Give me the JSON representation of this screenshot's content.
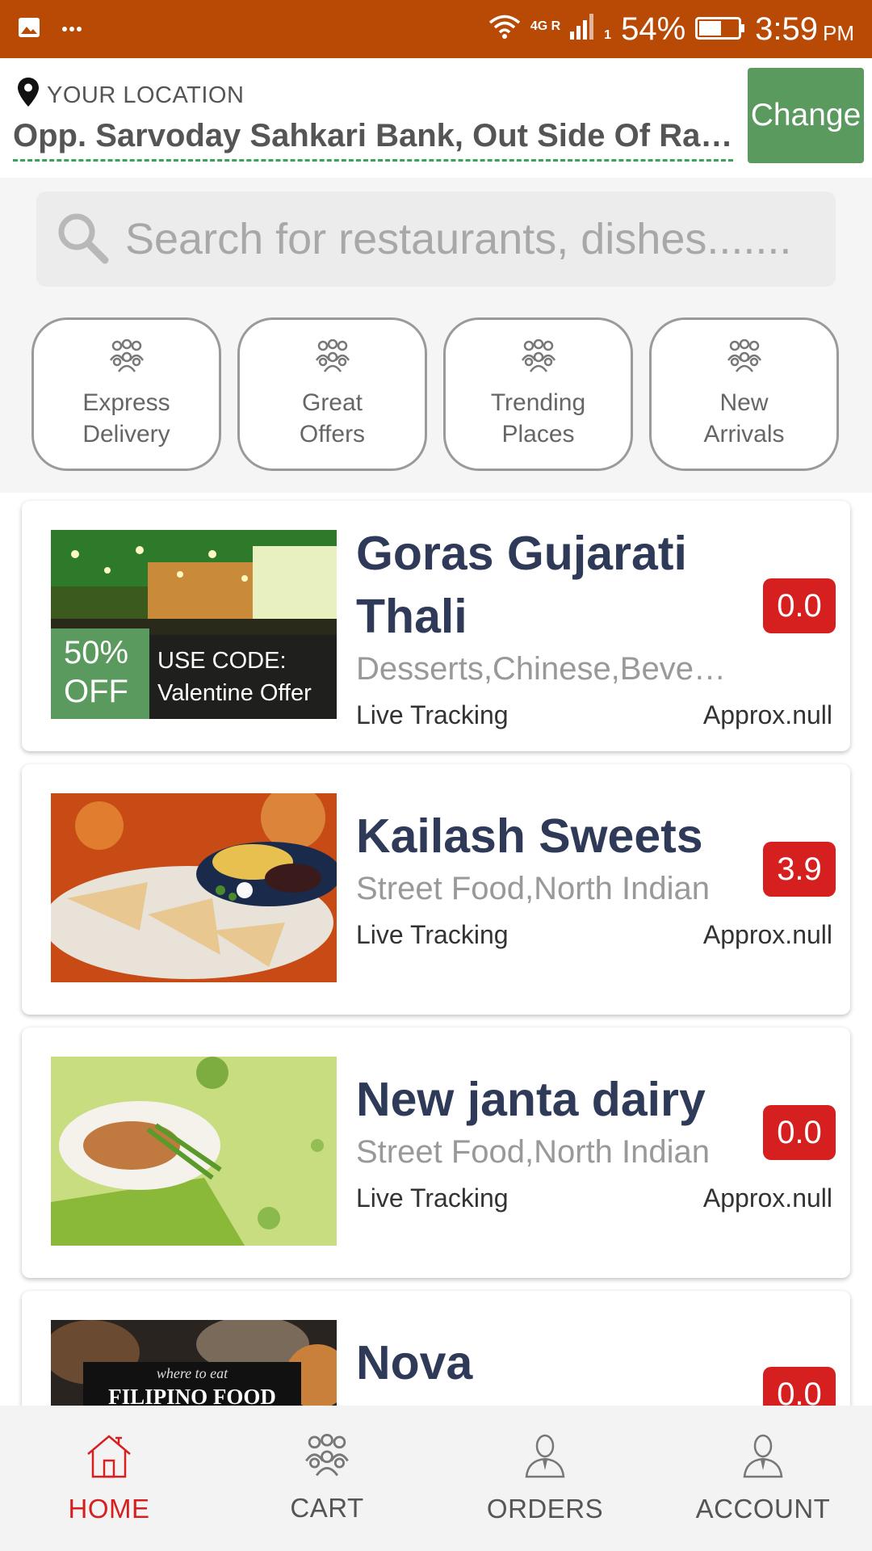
{
  "status_bar": {
    "network": "4G R",
    "sim": "1",
    "battery": "54%",
    "time": "3:59",
    "ampm": "PM",
    "icons": [
      "image-icon",
      "more-dots-icon",
      "wifi-icon",
      "signal-icon",
      "battery-icon"
    ]
  },
  "location": {
    "label": "YOUR LOCATION",
    "address": "Opp. Sarvoday Sahkari Bank, Out Side Of Railway",
    "change_label": "Change",
    "icon": "location-pin-icon"
  },
  "search": {
    "placeholder": "Search for restaurants, dishes.......",
    "icon": "search-icon"
  },
  "categories": [
    {
      "label": "Express Delivery",
      "icon": "group-icon"
    },
    {
      "label": "Great Offers",
      "icon": "group-icon"
    },
    {
      "label": "Trending Places",
      "icon": "group-icon"
    },
    {
      "label": "New Arrivals",
      "icon": "group-icon"
    }
  ],
  "restaurants": [
    {
      "name": "Goras Gujarati Thali",
      "cuisine": "Desserts,Chinese,Beverages",
      "tracking": "Live Tracking",
      "approx": "Approx.null",
      "rating": "0.0",
      "promo": {
        "off": "50% OFF",
        "code_label": "USE CODE:",
        "code": "Valentine Offer"
      }
    },
    {
      "name": "Kailash Sweets",
      "cuisine": "Street Food,North Indian",
      "tracking": "Live Tracking",
      "approx": "Approx.null",
      "rating": "3.9"
    },
    {
      "name": "New janta dairy",
      "cuisine": "Street Food,North Indian",
      "tracking": "Live Tracking",
      "approx": "Approx.null",
      "rating": "0.0"
    },
    {
      "name": "Nova Restaurant",
      "rating": "0.0",
      "image_text": {
        "line1": "where to eat",
        "line2": "FILIPINO FOOD"
      }
    }
  ],
  "bottom_nav": [
    {
      "label": "HOME",
      "icon": "home-icon",
      "active": true
    },
    {
      "label": "CART",
      "icon": "group-icon",
      "active": false
    },
    {
      "label": "ORDERS",
      "icon": "person-icon",
      "active": false
    },
    {
      "label": "ACCOUNT",
      "icon": "person-icon",
      "active": false
    }
  ],
  "colors": {
    "status_bar": "#b84a06",
    "accent_green": "#5a9a5e",
    "rating_red": "#d62020",
    "title_navy": "#2e3a58",
    "nav_active": "#d62020"
  }
}
